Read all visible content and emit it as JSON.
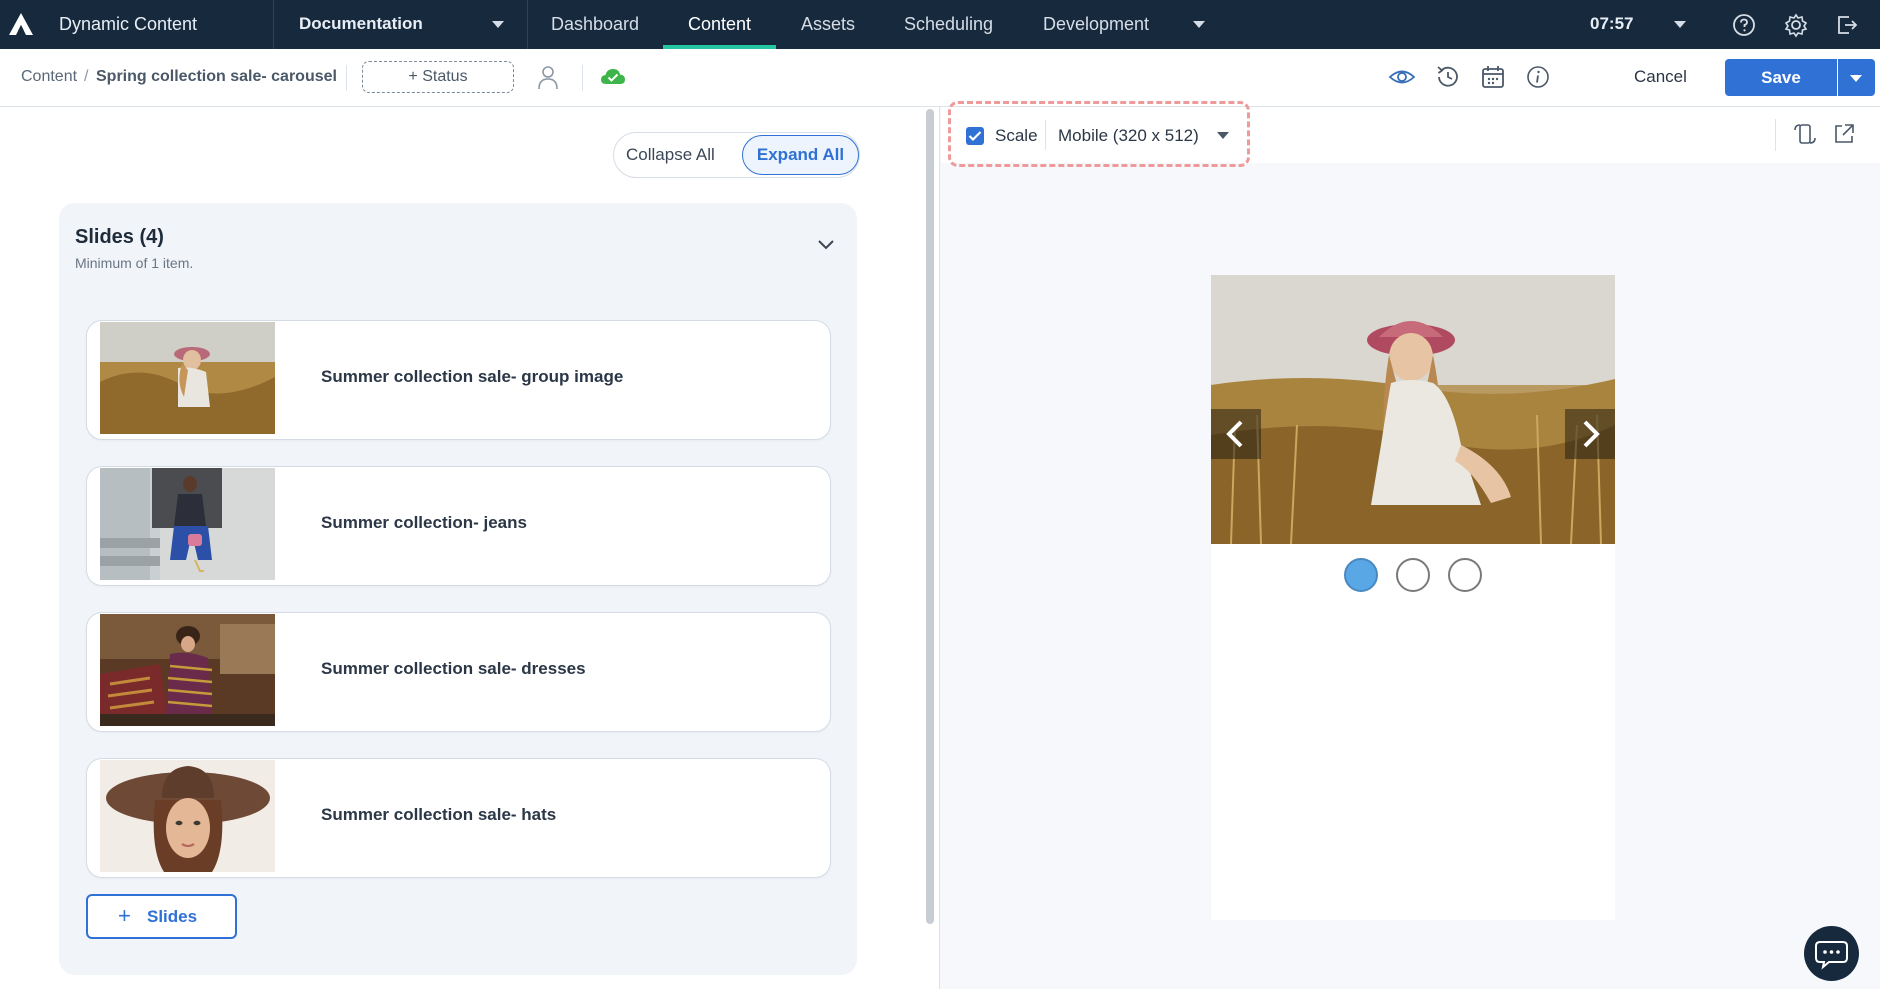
{
  "topnav": {
    "app_name": "Dynamic Content",
    "hub_name": "Documentation",
    "items": [
      {
        "label": "Dashboard",
        "active": false
      },
      {
        "label": "Content",
        "active": true
      },
      {
        "label": "Assets",
        "active": false
      },
      {
        "label": "Scheduling",
        "active": false
      },
      {
        "label": "Development",
        "active": false
      }
    ],
    "time": "07:57",
    "accent_color": "#26c6a2",
    "background_color": "#172a3d"
  },
  "toolbar": {
    "breadcrumb_root": "Content",
    "breadcrumb_sep": "/",
    "breadcrumb_current": "Spring collection sale- carousel",
    "status_label": "+ Status",
    "cancel_label": "Cancel",
    "save_label": "Save",
    "primary_color": "#2f71d4",
    "icons": [
      "user-icon",
      "cloud-check-icon",
      "eye-icon",
      "history-icon",
      "calendar-icon",
      "info-icon"
    ]
  },
  "editor": {
    "collapse_all": "Collapse All",
    "expand_all": "Expand All",
    "slides_title": "Slides (4)",
    "slides_subtitle": "Minimum of 1 item.",
    "slides": [
      {
        "label": "Summer collection sale- group image"
      },
      {
        "label": "Summer collection- jeans"
      },
      {
        "label": "Summer collection sale- dresses"
      },
      {
        "label": "Summer collection sale- hats"
      }
    ],
    "add_slides_label": "Slides"
  },
  "preview": {
    "scale_label": "Scale",
    "scale_checked": true,
    "device_option": "Mobile (320 x 512)",
    "carousel_dot_count": 3,
    "carousel_active_index": 0
  }
}
